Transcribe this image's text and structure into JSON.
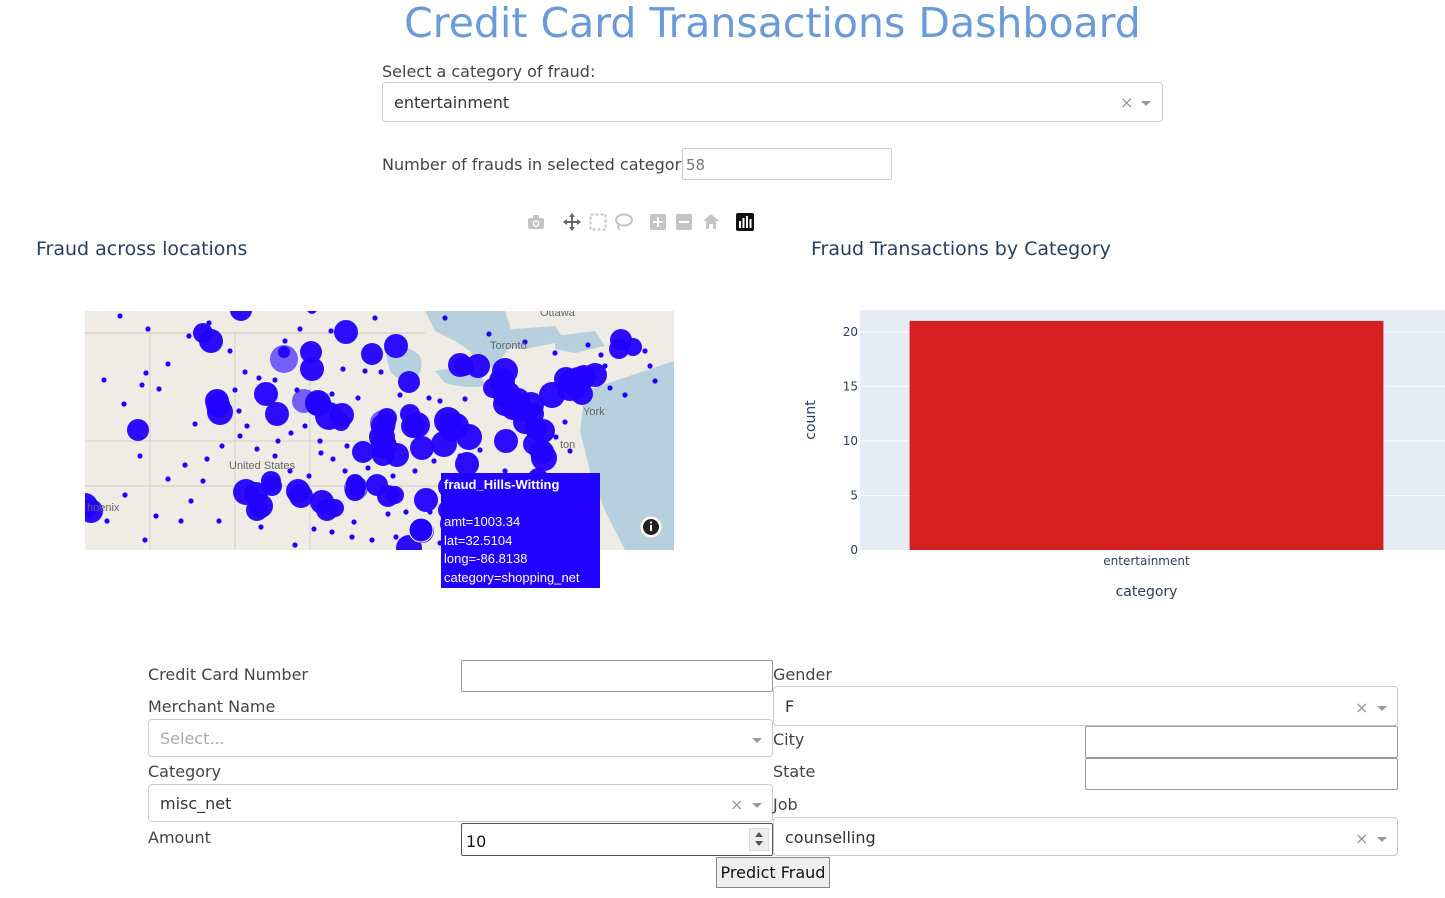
{
  "title": "Credit Card Transactions Dashboard",
  "category_select": {
    "label": "Select a category of fraud:",
    "value": "entertainment",
    "clear_glyph": "×"
  },
  "fraud_count": {
    "label": "Number of frauds in selected category:",
    "value": "58"
  },
  "modebar": {
    "icons": [
      "camera-icon",
      "pan-icon",
      "box-select-icon",
      "lasso-icon",
      "zoom-in-icon",
      "zoom-out-icon",
      "home-icon",
      "plotly-logo-icon"
    ]
  },
  "map_panel": {
    "title": "Fraud across locations",
    "place_labels": [
      "Ottawa",
      "Toronto",
      "United States",
      "hoenix",
      "York",
      "ton"
    ],
    "marker_color": "#2200ff",
    "tooltip": {
      "name": "fraud_Hills-Witting",
      "amt": "amt=1003.34",
      "lat": "lat=32.5104",
      "long": "long=-86.8138",
      "category": "category=shopping_net"
    },
    "info_icon": "info-icon"
  },
  "bar_panel": {
    "title": "Fraud Transactions by Category"
  },
  "chart_data": {
    "type": "bar",
    "categories": [
      "entertainment"
    ],
    "values": [
      21
    ],
    "title": "Fraud Transactions by Category",
    "xlabel": "category",
    "ylabel": "count",
    "ylim": [
      0,
      22
    ],
    "yticks": [
      0,
      5,
      10,
      15,
      20
    ],
    "bar_color": "#d62020",
    "plot_bg": "#e5ecf6",
    "grid": true
  },
  "form": {
    "cc_number": {
      "label": "Credit Card Number",
      "value": ""
    },
    "merchant": {
      "label": "Merchant Name",
      "placeholder": "Select..."
    },
    "category": {
      "label": "Category",
      "value": "misc_net"
    },
    "amount": {
      "label": "Amount",
      "value": "10"
    },
    "gender": {
      "label": "Gender",
      "value": "F"
    },
    "city": {
      "label": "City",
      "value": ""
    },
    "state": {
      "label": "State",
      "value": ""
    },
    "job": {
      "label": "Job",
      "value": "counselling"
    },
    "clear_glyph": "×",
    "submit_label": "Predict Fraud"
  }
}
